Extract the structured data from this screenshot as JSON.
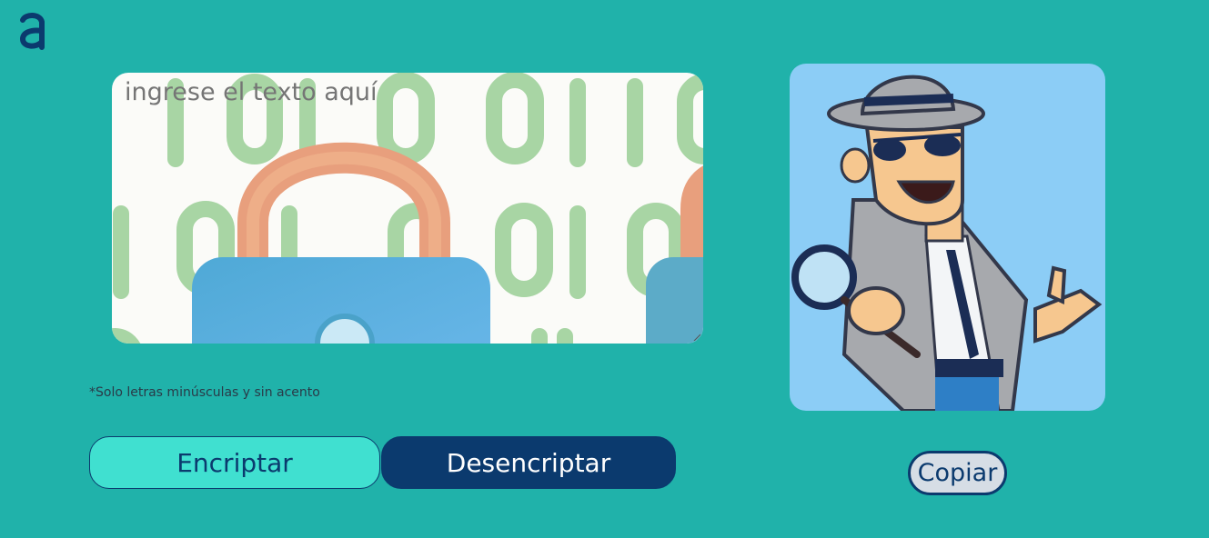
{
  "brand": {
    "logo_icon": "alura-a-logo-icon"
  },
  "input": {
    "placeholder": "ingrese el texto aquí",
    "value": ""
  },
  "hint": "*Solo letras minúsculas y sin acento",
  "buttons": {
    "encrypt_label": "Encriptar",
    "decrypt_label": "Desencriptar",
    "copy_label": "Copiar"
  },
  "illustrations": {
    "input_background": "binary-padlock-illustration",
    "output_placeholder": "detective-with-magnifier-illustration"
  },
  "colors": {
    "page_background": "#20b2aa",
    "encrypt_button": "#40e0d0",
    "primary": "#0b3a6e",
    "output_panel": "#8ccdf6"
  }
}
